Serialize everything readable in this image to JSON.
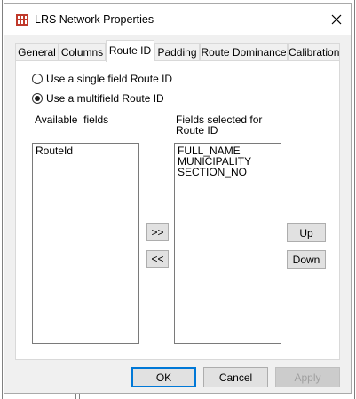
{
  "window": {
    "title": "LRS Network Properties",
    "close_glyph": "✕"
  },
  "tabs": [
    {
      "label": "General",
      "active": false
    },
    {
      "label": "Columns",
      "active": false
    },
    {
      "label": "Route ID",
      "active": true
    },
    {
      "label": "Padding",
      "active": false
    },
    {
      "label": "Route Dominance",
      "active": false
    },
    {
      "label": "Calibration",
      "active": false
    }
  ],
  "route_id": {
    "single_field_label": "Use a single field Route ID",
    "single_field_selected": false,
    "multifield_label": "Use a multifield Route ID",
    "multifield_selected": true,
    "available_label": "Available  fields",
    "available_fields": [
      "RouteId"
    ],
    "selected_label_line1": "Fields selected for",
    "selected_label_line2": "Route ID",
    "selected_fields": [
      "FULL_NAME",
      "MUNICIPALITY",
      "SECTION_NO"
    ],
    "add_button": ">>",
    "remove_button": "<<",
    "up_button": "Up",
    "down_button": "Down"
  },
  "footer": {
    "ok": "OK",
    "cancel": "Cancel",
    "apply": "Apply",
    "apply_enabled": false
  },
  "colors": {
    "accent": "#0078d7",
    "app_icon": "#c0392b"
  },
  "icons": {
    "app": "lrs-network-icon",
    "close": "close-icon"
  }
}
